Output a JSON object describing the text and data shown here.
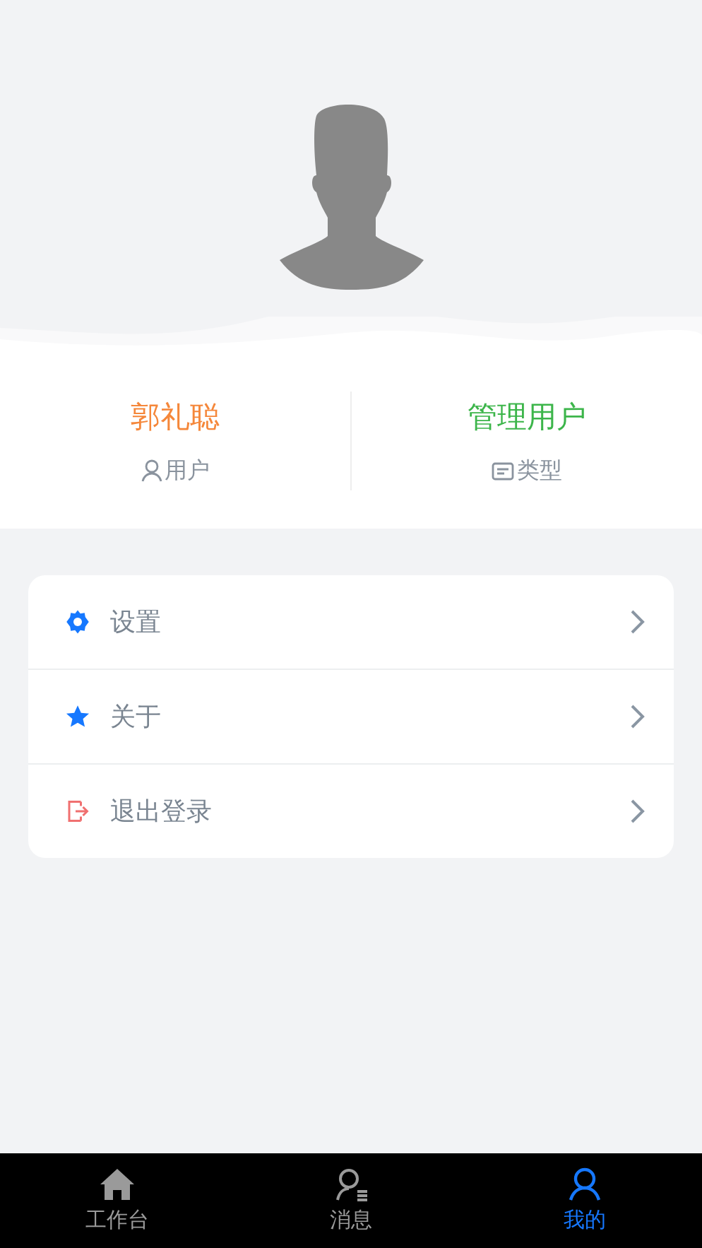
{
  "profile": {
    "name": "郭礼聪",
    "name_label": "用户",
    "type": "管理用户",
    "type_label": "类型"
  },
  "menu": [
    {
      "kind": "settings",
      "label": "设置"
    },
    {
      "kind": "star",
      "label": "关于"
    },
    {
      "kind": "logout",
      "label": "退出登录"
    }
  ],
  "tab_bar": [
    {
      "kind": "home",
      "label": "工作台",
      "selected": false
    },
    {
      "kind": "messages",
      "label": "消息",
      "selected": false
    },
    {
      "kind": "me",
      "label": "我的",
      "selected": true
    }
  ]
}
